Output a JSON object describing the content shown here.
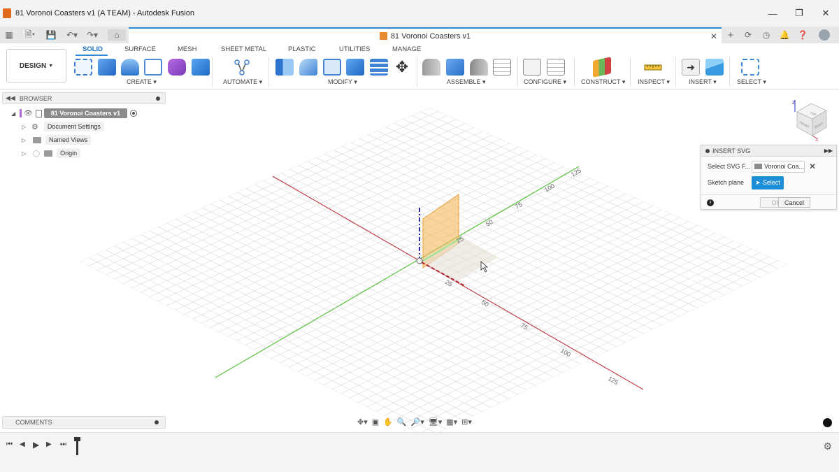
{
  "window": {
    "title": "81 Voronoi Coasters v1 (A TEAM) - Autodesk Fusion",
    "controls": [
      "minimize",
      "restore",
      "close"
    ]
  },
  "document_tab": {
    "title": "81 Voronoi Coasters v1",
    "close_icon": "close-icon"
  },
  "workspace": {
    "label": "DESIGN"
  },
  "ribbon": {
    "tabs": [
      {
        "label": "SOLID",
        "active": true
      },
      {
        "label": "SURFACE",
        "active": false
      },
      {
        "label": "MESH",
        "active": false
      },
      {
        "label": "SHEET METAL",
        "active": false
      },
      {
        "label": "PLASTIC",
        "active": false
      },
      {
        "label": "UTILITIES",
        "active": false
      },
      {
        "label": "MANAGE",
        "active": false
      }
    ],
    "groups": [
      "CREATE",
      "AUTOMATE",
      "MODIFY",
      "ASSEMBLE",
      "CONFIGURE",
      "CONSTRUCT",
      "INSPECT",
      "INSERT",
      "SELECT"
    ],
    "accent_color": "#2f89d8"
  },
  "browser": {
    "title": "BROWSER",
    "items": [
      {
        "label": "81 Voronoi Coasters v1",
        "icon": "document-icon"
      },
      {
        "label": "Document Settings",
        "icon": "gear-icon"
      },
      {
        "label": "Named Views",
        "icon": "folder-icon"
      },
      {
        "label": "Origin",
        "icon": "folder-icon"
      }
    ]
  },
  "viewport": {
    "axis_labels": [
      "125",
      "100",
      "75",
      "50",
      "25",
      "25",
      "50",
      "75",
      "100",
      "125"
    ],
    "grid_color": "#d9d9d9",
    "x_axis_color": "#c0404a",
    "y_axis_color": "#56c23e",
    "z_axis_color": "#2a2ab0",
    "plane_color": "#f5b85b"
  },
  "viewcube": {
    "faces": [
      "TOP",
      "FRONT",
      "RIGHT"
    ],
    "axis_labels": [
      "Z",
      "X"
    ]
  },
  "insert_svg_dialog": {
    "title": "INSERT SVG",
    "select_file_label": "Select SVG F...",
    "file_value": "Voronoi Coa...",
    "sketch_plane_label": "Sketch plane",
    "select_button": "Select",
    "ok_button": "OK",
    "cancel_button": "Cancel"
  },
  "comments": {
    "title": "COMMENTS"
  }
}
